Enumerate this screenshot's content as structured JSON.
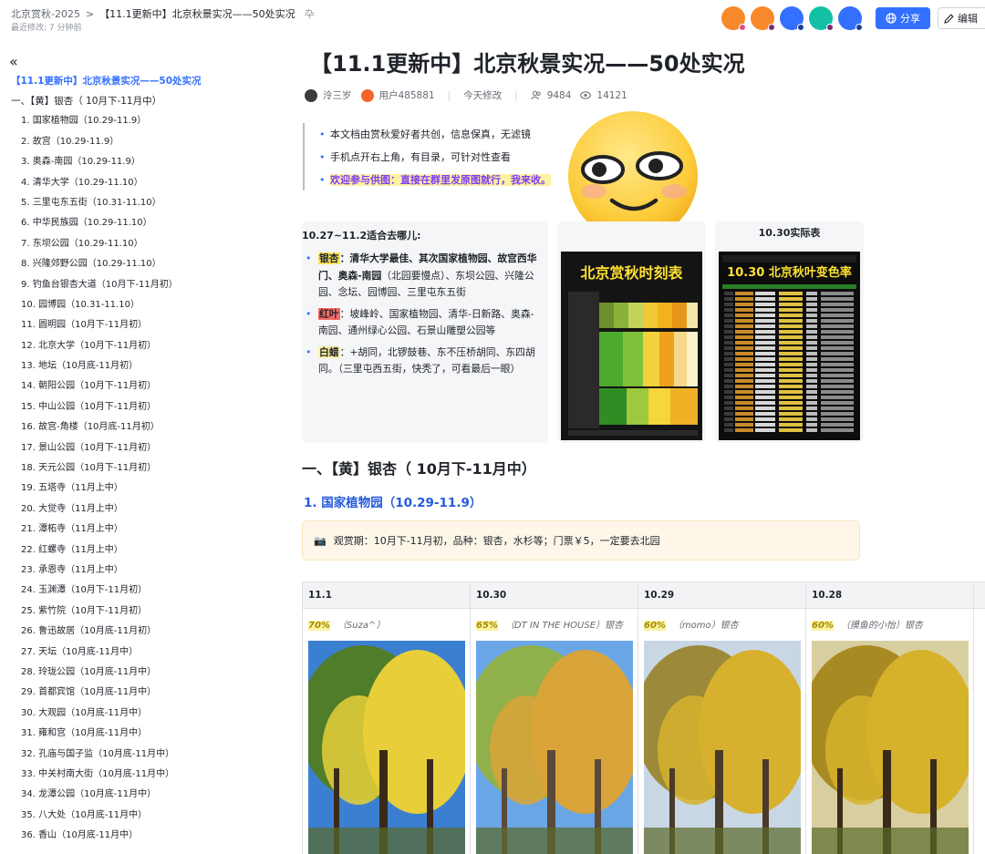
{
  "topbar": {
    "breadcrumb_root": "北京赏秋-2025",
    "breadcrumb_sep": ">",
    "breadcrumb_current": "【11.1更新中】北京秋景实况——50处实况",
    "last_modified": "最近修改: 7 分钟前",
    "share_label": "分享",
    "edit_label": "编辑",
    "avatars": [
      {
        "color": "#f7892a",
        "dot": "#e34d87"
      },
      {
        "color": "#f7892a",
        "dot": "#7a2c6e"
      },
      {
        "color": "#3370ff",
        "dot": "#1d3f8f"
      },
      {
        "color": "#14c0a3",
        "dot": "#7a2c6e"
      },
      {
        "color": "#3370ff",
        "dot": "#1d3f8f"
      }
    ]
  },
  "sidebar": {
    "title": "【11.1更新中】北京秋景实况——50处实况",
    "section": "一、【黄】银杏（ 10月下-11月中）",
    "items": [
      "1. 国家植物园（10.29-11.9）",
      "2. 故宫（10.29-11.9）",
      "3. 奥森-南园（10.29-11.9）",
      "4. 清华大学（10.29-11.10）",
      "5. 三里屯东五街（10.31-11.10）",
      "6. 中华民族园（10.29-11.10）",
      "7. 东坝公园（10.29-11.10）",
      "8. 兴隆郊野公园（10.29-11.10）",
      "9. 钓鱼台银杏大道（10月下-11月初）",
      "10. 园博园（10.31-11.10）",
      "11. 圆明园（10月下-11月初）",
      "12. 北京大学（10月下-11月初）",
      "13. 地坛（10月底-11月初）",
      "14. 朝阳公园（10月下-11月初）",
      "15. 中山公园（10月下-11月初）",
      "16. 故宫-角楼（10月底-11月初）",
      "17. 景山公园（10月下-11月初）",
      "18. 天元公园（10月下-11月初）",
      "19. 五塔寺（11月上中）",
      "20. 大觉寺（11月上中）",
      "21. 潭柘寺（11月上中）",
      "22. 红螺寺（11月上中）",
      "23. 承恩寺（11月上中）",
      "24. 玉渊潭（10月下-11月初）",
      "25. 紫竹院（10月下-11月初）",
      "26. 鲁迅故居（10月底-11月初）",
      "27. 天坛（10月底-11月中）",
      "28. 玲珑公园（10月底-11月中）",
      "29. 首都宾馆（10月底-11月中）",
      "30. 大观园（10月底-11月中）",
      "31. 雍和宫（10月底-11月中）",
      "32. 孔庙与国子监（10月底-11月中）",
      "33. 中关村南大街（10月底-11月中）",
      "34. 龙潭公园（10月底-11月中）",
      "35. 八大处（10月底-11月中）",
      "36. 香山（10月底-11月中）"
    ]
  },
  "doc": {
    "title": "【11.1更新中】北京秋景实况——50处实况",
    "author1": "泠三岁",
    "author2": "用户485881",
    "modified": "今天修改",
    "readers": "9484",
    "views": "14121",
    "callout": [
      "本文档由赏秋爱好者共创，信息保真，无滤镜",
      "手机点开右上角，有目录，可针对性查看",
      "欢迎参与供图：直接在群里发原图就行，我来收。"
    ],
    "callout_tail": "eng"
  },
  "guide": {
    "heading": "10.27~11.2适合去哪儿:",
    "ginkgo_tag": "银杏",
    "ginkgo_bold": "：清华大学最佳、其次国家植物园、故宫西华门、奥森-南园",
    "ginkgo_rest": "（北园要慢点）、东坝公园、兴隆公园、念坛、园博园、三里屯东五街",
    "red_tag": "红叶",
    "red_rest": "：坡峰岭、国家植物园、清华-日新路、奥森-南园、通州绿心公园、石景山雕塑公园等",
    "wax_tag": "白蜡",
    "wax_rest": "：+胡同，北锣鼓巷、东不压桥胡同、东四胡同。（三里屯西五街，快秃了，可看最后一眼）"
  },
  "cards": {
    "card2_caption": "10.30实际表",
    "poster1_title": "北京赏秋时刻表",
    "poster2_title": "10.30 北京秋叶变色率"
  },
  "section1": {
    "heading": "一、【黄】银杏（ 10月下-11月中）",
    "sub": "1. 国家植物园（10.29-11.9）",
    "note": "观赏期：10月下-11月初，品种：银杏，水杉等；门票￥5，一定要去北园",
    "note_icon": "📷"
  },
  "table": {
    "columns": [
      {
        "header": "11.1",
        "pct": "70%",
        "credit": "（Suza^）"
      },
      {
        "header": "10.30",
        "pct": "65%",
        "credit": "（DT IN THE HOUSE）银杏"
      },
      {
        "header": "10.29",
        "pct": "60%",
        "credit": "（momo）银杏"
      },
      {
        "header": "10.28",
        "pct": "60%",
        "credit": "（摸鱼的小怡）银杏"
      }
    ]
  }
}
